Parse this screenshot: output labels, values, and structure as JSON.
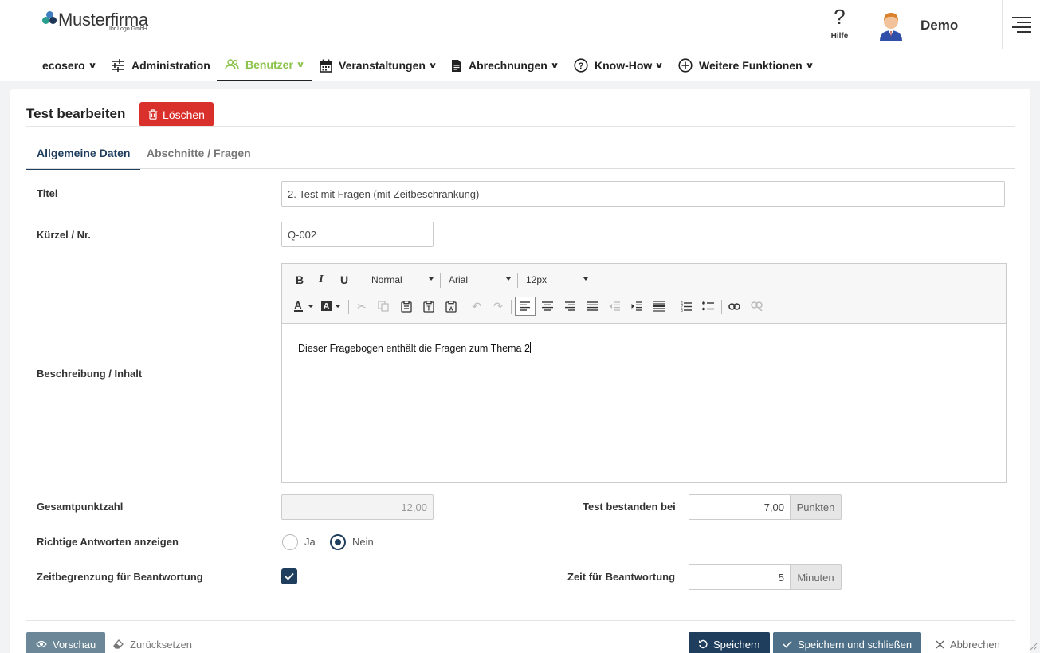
{
  "header": {
    "logo_name": "Musterfirma",
    "logo_sub": "Ihr Logo GmbH",
    "help_label": "Hilfe",
    "user_name": "Demo"
  },
  "nav": {
    "items": [
      {
        "label": "ecosero",
        "icon": "none",
        "has_menu": true
      },
      {
        "label": "Administration",
        "icon": "sliders-icon",
        "has_menu": false
      },
      {
        "label": "Benutzer",
        "icon": "users-icon",
        "has_menu": true,
        "active": true
      },
      {
        "label": "Veranstaltungen",
        "icon": "calendar-icon",
        "has_menu": true
      },
      {
        "label": "Abrechnungen",
        "icon": "document-icon",
        "has_menu": true
      },
      {
        "label": "Know-How",
        "icon": "question-circle-icon",
        "has_menu": true
      },
      {
        "label": "Weitere Funktionen",
        "icon": "plus-circle-icon",
        "has_menu": true
      }
    ]
  },
  "page": {
    "title": "Test bearbeiten",
    "delete_label": "Löschen",
    "tabs": [
      {
        "label": "Allgemeine Daten",
        "active": true
      },
      {
        "label": "Abschnitte / Fragen",
        "active": false
      }
    ]
  },
  "form": {
    "title_label": "Titel",
    "title_value": "2. Test mit Fragen (mit Zeitbeschränkung)",
    "code_label": "Kürzel / Nr.",
    "code_value": "Q-002",
    "description_label": "Beschreibung / Inhalt",
    "editor": {
      "format": "Normal",
      "font": "Arial",
      "size": "12px",
      "content": "Dieser Fragebogen enthält die Fragen zum Thema 2"
    },
    "total_points_label": "Gesamtpunktzahl",
    "total_points_value": "12,00",
    "pass_label": "Test bestanden bei",
    "pass_value": "7,00",
    "pass_unit": "Punkten",
    "show_answers_label": "Richtige Antworten anzeigen",
    "radio_yes": "Ja",
    "radio_no": "Nein",
    "show_answers_selected": "Nein",
    "time_limit_label": "Zeitbegrenzung für Beantwortung",
    "time_limit_checked": true,
    "time_label": "Zeit für Beantwortung",
    "time_value": "5",
    "time_unit": "Minuten"
  },
  "footer": {
    "preview": "Vorschau",
    "reset": "Zurücksetzen",
    "save": "Speichern",
    "save_close": "Speichern und schließen",
    "cancel": "Abbrechen"
  },
  "colors": {
    "accent_green": "#8bc34a",
    "primary_dark": "#1f3e5e",
    "danger": "#d9302c"
  }
}
